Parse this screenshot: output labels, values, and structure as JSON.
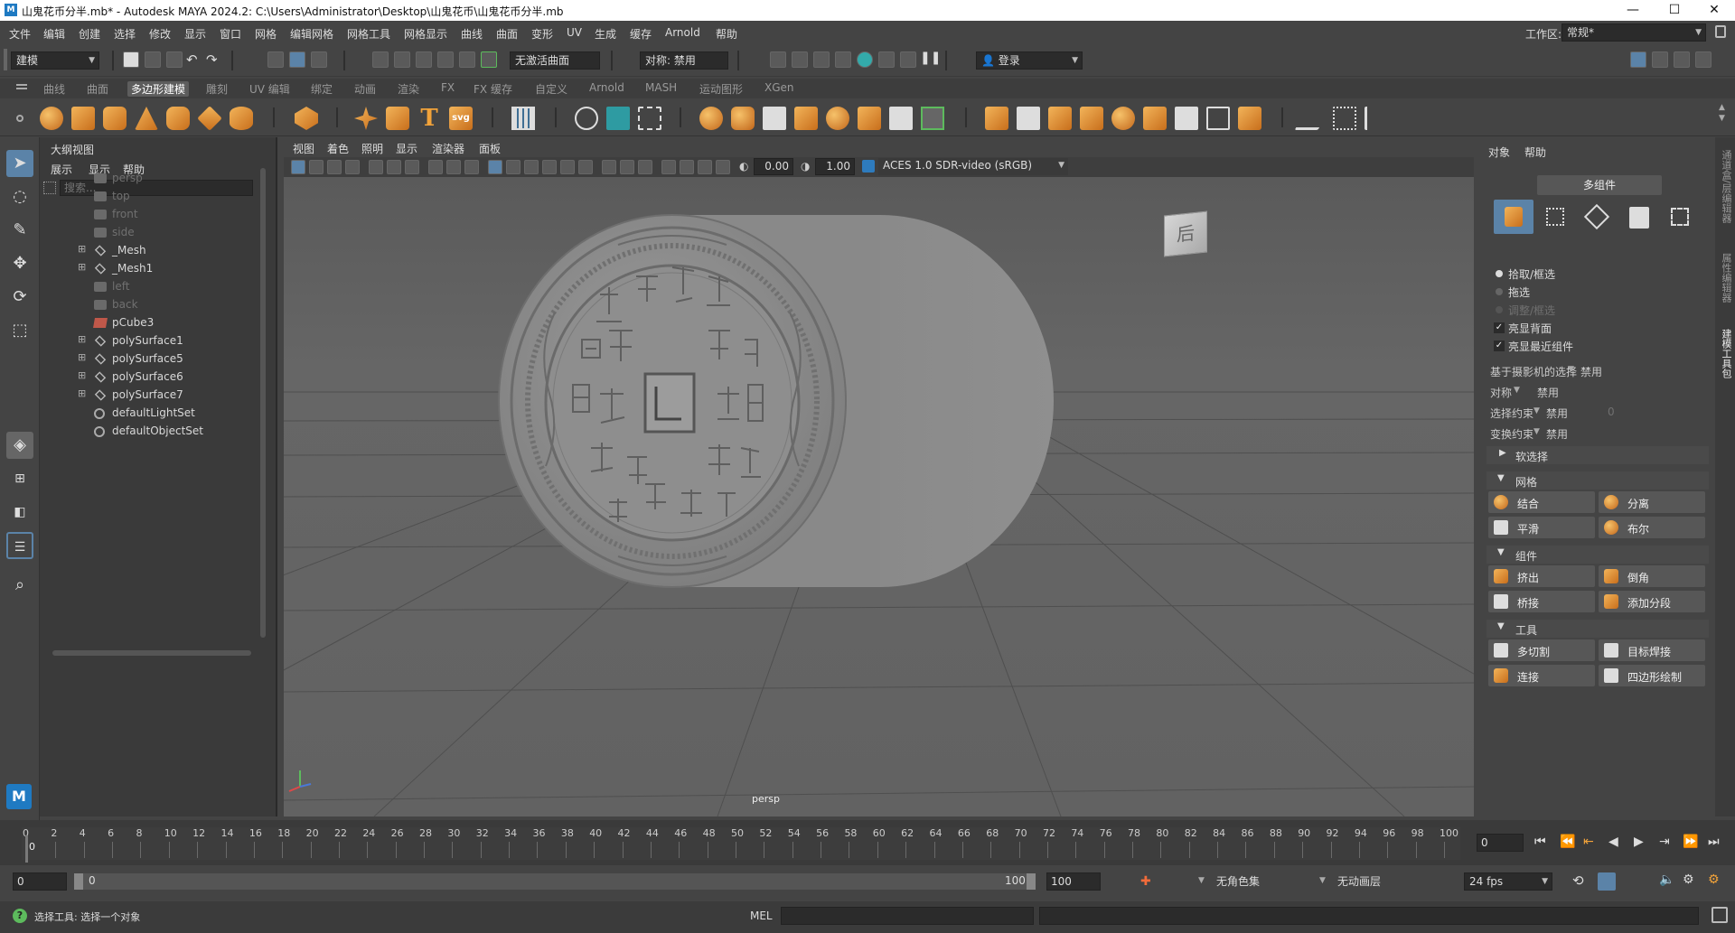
{
  "window": {
    "title": "山鬼花币分半.mb* - Autodesk MAYA 2024.2: C:\\Users\\Administrator\\Desktop\\山鬼花币\\山鬼花币分半.mb",
    "controls": [
      "—",
      "☐",
      "✕"
    ]
  },
  "menubar": {
    "items": [
      "文件",
      "编辑",
      "创建",
      "选择",
      "修改",
      "显示",
      "窗口",
      "网格",
      "编辑网格",
      "网格工具",
      "网格显示",
      "曲线",
      "曲面",
      "变形",
      "UV",
      "生成",
      "缓存",
      "Arnold",
      "帮助"
    ],
    "workspace_label": "工作区:",
    "workspace_value": "常规*"
  },
  "statusline": {
    "mode": "建模",
    "live_surface": "无激活曲面",
    "symmetry": "对称: 禁用",
    "login": "登录"
  },
  "shelf": {
    "tabs": [
      "曲线",
      "曲面",
      "多边形建模",
      "雕刻",
      "UV 编辑",
      "绑定",
      "动画",
      "渲染",
      "FX",
      "FX 缓存",
      "自定义",
      "Arnold",
      "MASH",
      "运动图形",
      "XGen"
    ],
    "active_tab": "多边形建模",
    "svg_label": "svg",
    "text_label": "T"
  },
  "outliner": {
    "title": "大纲视图",
    "menus": [
      "展示",
      "显示",
      "帮助"
    ],
    "search_placeholder": "搜索...",
    "items": [
      {
        "label": "persp",
        "icon": "camera-icon",
        "dim": true,
        "expand": ""
      },
      {
        "label": "top",
        "icon": "camera-icon",
        "dim": true,
        "expand": ""
      },
      {
        "label": "front",
        "icon": "camera-icon",
        "dim": true,
        "expand": ""
      },
      {
        "label": "side",
        "icon": "camera-icon",
        "dim": true,
        "expand": ""
      },
      {
        "label": "_Mesh",
        "icon": "transform-icon",
        "dim": false,
        "expand": "⊞"
      },
      {
        "label": "_Mesh1",
        "icon": "transform-icon",
        "dim": false,
        "expand": "⊞"
      },
      {
        "label": "left",
        "icon": "camera-icon",
        "dim": true,
        "expand": ""
      },
      {
        "label": "back",
        "icon": "camera-icon",
        "dim": true,
        "expand": ""
      },
      {
        "label": "pCube3",
        "icon": "mesh-icon",
        "dim": false,
        "expand": ""
      },
      {
        "label": "polySurface1",
        "icon": "transform-icon",
        "dim": false,
        "expand": "⊞"
      },
      {
        "label": "polySurface5",
        "icon": "transform-icon",
        "dim": false,
        "expand": "⊞"
      },
      {
        "label": "polySurface6",
        "icon": "transform-icon",
        "dim": false,
        "expand": "⊞"
      },
      {
        "label": "polySurface7",
        "icon": "transform-icon",
        "dim": false,
        "expand": "⊞"
      },
      {
        "label": "defaultLightSet",
        "icon": "set-icon",
        "dim": false,
        "expand": ""
      },
      {
        "label": "defaultObjectSet",
        "icon": "set-icon",
        "dim": false,
        "expand": ""
      }
    ]
  },
  "viewport": {
    "menus": [
      "视图",
      "着色",
      "照明",
      "显示",
      "渲染器",
      "面板"
    ],
    "exposure": "0.00",
    "gamma": "1.00",
    "colorspace": "ACES 1.0 SDR-video (sRGB)",
    "camera_label": "persp",
    "viewcube_label": "后"
  },
  "rightpanel": {
    "menus": [
      "对象",
      "帮助"
    ],
    "multi_component": "多组件",
    "radios": [
      "拾取/框选",
      "拖选",
      "调整/框选"
    ],
    "checks": [
      "亮显背面",
      "亮显最近组件"
    ],
    "camera_select_label": "基于摄影机的选择",
    "camera_select_value": "禁用",
    "symmetry_label": "对称",
    "symmetry_value": "禁用",
    "select_constraint_label": "选择约束",
    "select_constraint_value": "禁用",
    "select_constraint_num": "0",
    "transform_constraint_label": "变换约束",
    "transform_constraint_value": "禁用",
    "soft_select": "软选择",
    "mesh_section": "网格",
    "mesh_buttons": [
      "结合",
      "分离",
      "平滑",
      "布尔"
    ],
    "component_section": "组件",
    "component_buttons": [
      "挤出",
      "倒角",
      "桥接",
      "添加分段"
    ],
    "tools_section": "工具",
    "tools_buttons": [
      "多切割",
      "目标焊接",
      "连接",
      "四边形绘制"
    ],
    "side_tabs": [
      "通道盒/层编辑器",
      "属性编辑器",
      "建模工具包"
    ]
  },
  "timeline": {
    "ticks": [
      "0",
      "2",
      "4",
      "6",
      "8",
      "10",
      "12",
      "14",
      "16",
      "18",
      "20",
      "22",
      "24",
      "26",
      "28",
      "30",
      "32",
      "34",
      "36",
      "38",
      "40",
      "42",
      "44",
      "46",
      "48",
      "50",
      "52",
      "54",
      "56",
      "58",
      "60",
      "62",
      "64",
      "66",
      "68",
      "70",
      "72",
      "74",
      "76",
      "78",
      "80",
      "82",
      "84",
      "86",
      "88",
      "90",
      "92",
      "94",
      "96",
      "98",
      "100"
    ],
    "current_frame": "0",
    "current_frame_box": "0"
  },
  "range": {
    "start": "0",
    "inner_start": "0",
    "inner_end": "100",
    "end": "100",
    "char_set": "无角色集",
    "anim_layer": "无动画层",
    "fps": "24 fps"
  },
  "commandline": {
    "help_text": "选择工具: 选择一个对象",
    "lang": "MEL"
  }
}
